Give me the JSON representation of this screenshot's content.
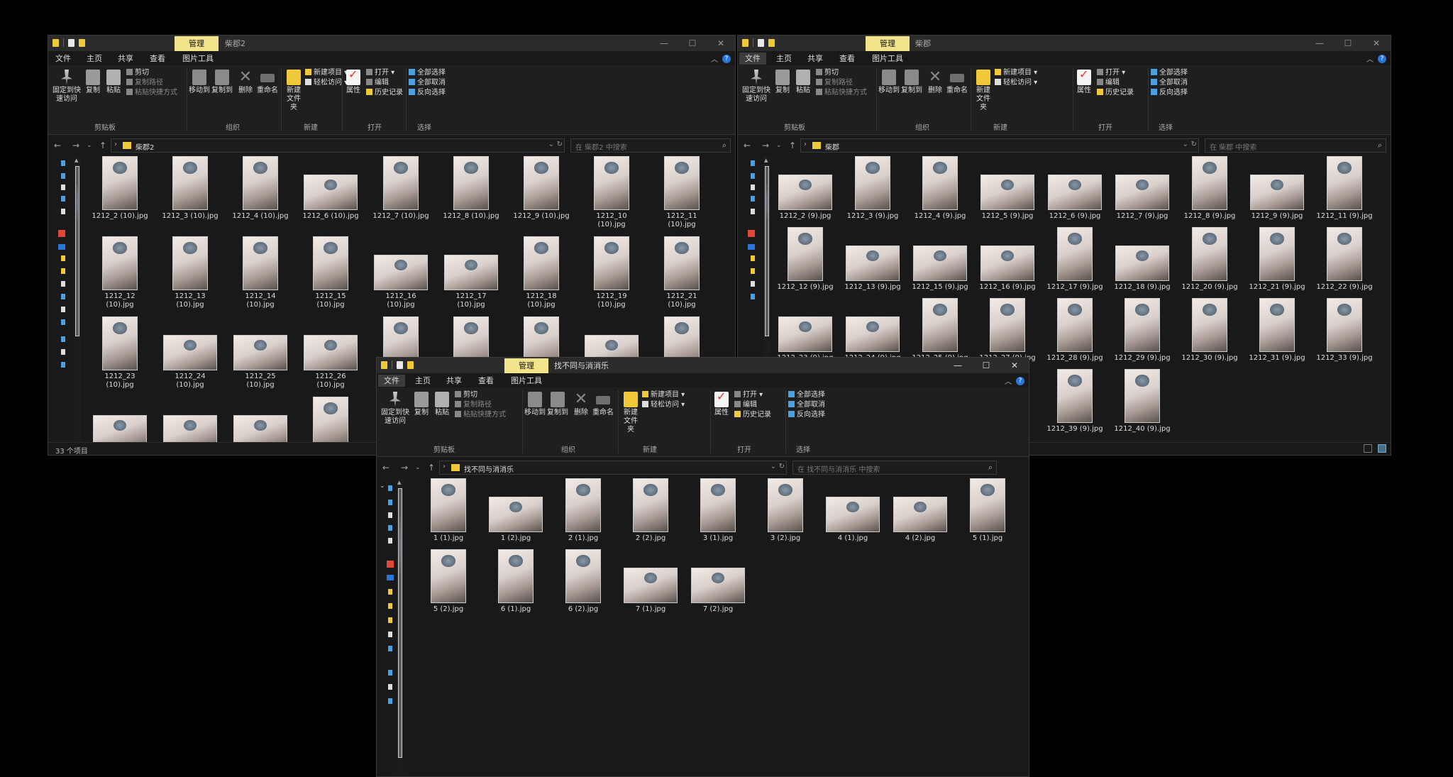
{
  "windows": [
    {
      "id": "w1",
      "manage_tab": "管理",
      "title": "柴郡2",
      "tabs": [
        "文件",
        "主页",
        "共享",
        "查看",
        "图片工具"
      ],
      "ribbon": {
        "pin": "固定到快速访问",
        "copy": "复制",
        "paste": "粘贴",
        "cut": "剪切",
        "copy_path": "复制路径",
        "paste_shortcut": "粘贴快捷方式",
        "move_to": "移动到",
        "copy_to": "复制到",
        "delete": "删除",
        "rename": "重命名",
        "new_folder": "新建文件夹",
        "new_item": "新建项目",
        "easy_access": "轻松访问",
        "properties": "属性",
        "open": "打开",
        "edit": "编辑",
        "history": "历史记录",
        "select_all": "全部选择",
        "select_none": "全部取消",
        "invert": "反向选择",
        "groups": [
          "剪贴板",
          "组织",
          "新建",
          "打开",
          "选择"
        ]
      },
      "address": "柴郡2",
      "search_placeholder": "在 柴郡2 中搜索",
      "status": "33 个项目",
      "files": [
        {
          "name": "1212_2 (10).jpg"
        },
        {
          "name": "1212_3 (10).jpg"
        },
        {
          "name": "1212_4 (10).jpg"
        },
        {
          "name": "1212_6 (10).jpg"
        },
        {
          "name": "1212_7 (10).jpg"
        },
        {
          "name": "1212_8 (10).jpg"
        },
        {
          "name": "1212_9 (10).jpg"
        },
        {
          "name": "1212_10\n(10).jpg"
        },
        {
          "name": "1212_11\n(10).jpg"
        },
        {
          "name": "1212_12\n(10).jpg"
        },
        {
          "name": "1212_13\n(10).jpg"
        },
        {
          "name": "1212_14\n(10).jpg"
        },
        {
          "name": "1212_15\n(10).jpg"
        },
        {
          "name": "1212_16\n(10).jpg"
        },
        {
          "name": "1212_17\n(10).jpg"
        },
        {
          "name": "1212_18\n(10).jpg"
        },
        {
          "name": "1212_19\n(10).jpg"
        },
        {
          "name": "1212_21\n(10).jpg"
        },
        {
          "name": "1212_23\n(10).jpg"
        },
        {
          "name": "1212_24\n(10).jpg"
        },
        {
          "name": "1212_25\n(10).jpg"
        },
        {
          "name": "1212_26\n(10).jpg"
        },
        {
          "name": ""
        },
        {
          "name": ""
        },
        {
          "name": ""
        },
        {
          "name": ""
        },
        {
          "name": ""
        },
        {
          "name": ""
        },
        {
          "name": ""
        },
        {
          "name": ""
        },
        {
          "name": ""
        }
      ]
    },
    {
      "id": "w2",
      "manage_tab": "管理",
      "title": "柴郡",
      "tabs": [
        "文件",
        "主页",
        "共享",
        "查看",
        "图片工具"
      ],
      "ribbon": {
        "pin": "固定到快速访问",
        "copy": "复制",
        "paste": "粘贴",
        "cut": "剪切",
        "copy_path": "复制路径",
        "paste_shortcut": "粘贴快捷方式",
        "move_to": "移动到",
        "copy_to": "复制到",
        "delete": "删除",
        "rename": "重命名",
        "new_folder": "新建文件夹",
        "new_item": "新建项目",
        "easy_access": "轻松访问",
        "properties": "属性",
        "open": "打开",
        "edit": "编辑",
        "history": "历史记录",
        "select_all": "全部选择",
        "select_none": "全部取消",
        "invert": "反向选择",
        "groups": [
          "剪贴板",
          "组织",
          "新建",
          "打开",
          "选择"
        ]
      },
      "address": "柴郡",
      "search_placeholder": "在 柴郡 中搜索",
      "files": [
        {
          "name": "1212_2 (9).jpg"
        },
        {
          "name": "1212_3 (9).jpg"
        },
        {
          "name": "1212_4 (9).jpg"
        },
        {
          "name": "1212_5 (9).jpg"
        },
        {
          "name": "1212_6 (9).jpg"
        },
        {
          "name": "1212_7 (9).jpg"
        },
        {
          "name": "1212_8 (9).jpg"
        },
        {
          "name": "1212_9 (9).jpg"
        },
        {
          "name": "1212_11 (9).jpg"
        },
        {
          "name": "1212_12 (9).jpg"
        },
        {
          "name": "1212_13 (9).jpg"
        },
        {
          "name": "1212_15 (9).jpg"
        },
        {
          "name": "1212_16 (9).jpg"
        },
        {
          "name": "1212_17 (9).jpg"
        },
        {
          "name": "1212_18 (9).jpg"
        },
        {
          "name": "1212_20 (9).jpg"
        },
        {
          "name": "1212_21 (9).jpg"
        },
        {
          "name": "1212_22 (9).jpg"
        },
        {
          "name": "1212_23 (9).jpg"
        },
        {
          "name": "1212_24 (9).jpg"
        },
        {
          "name": "1212_25 (9).jpg"
        },
        {
          "name": "1212_27 (9).jpg"
        },
        {
          "name": "1212_28 (9).jpg"
        },
        {
          "name": "1212_29 (9).jpg"
        },
        {
          "name": "1212_30 (9).jpg"
        },
        {
          "name": "1212_31 (9).jpg"
        },
        {
          "name": "1212_33 (9).jpg"
        },
        {
          "name": "jpg"
        },
        {
          "name": "1212_39 (9).jpg"
        },
        {
          "name": "1212_40 (9).jpg"
        }
      ]
    },
    {
      "id": "w3",
      "manage_tab": "管理",
      "title": "找不同与消消乐",
      "tabs": [
        "文件",
        "主页",
        "共享",
        "查看",
        "图片工具"
      ],
      "ribbon": {
        "pin": "固定到快速访问",
        "copy": "复制",
        "paste": "粘贴",
        "cut": "剪切",
        "copy_path": "复制路径",
        "paste_shortcut": "粘贴快捷方式",
        "move_to": "移动到",
        "copy_to": "复制到",
        "delete": "删除",
        "rename": "重命名",
        "new_folder": "新建文件夹",
        "new_item": "新建项目",
        "easy_access": "轻松访问",
        "properties": "属性",
        "open": "打开",
        "edit": "编辑",
        "history": "历史记录",
        "select_all": "全部选择",
        "select_none": "全部取消",
        "invert": "反向选择",
        "groups": [
          "剪贴板",
          "组织",
          "新建",
          "打开",
          "选择"
        ]
      },
      "address": "找不同与消消乐",
      "search_placeholder": "在 找不同与消消乐 中搜索",
      "files": [
        {
          "name": "1 (1).jpg"
        },
        {
          "name": "1 (2).jpg"
        },
        {
          "name": "2 (1).jpg"
        },
        {
          "name": "2 (2).jpg"
        },
        {
          "name": "3 (1).jpg"
        },
        {
          "name": "3 (2).jpg"
        },
        {
          "name": "4 (1).jpg"
        },
        {
          "name": "4 (2).jpg"
        },
        {
          "name": "5 (1).jpg"
        },
        {
          "name": "5 (2).jpg"
        },
        {
          "name": "6 (1).jpg"
        },
        {
          "name": "6 (2).jpg"
        },
        {
          "name": "7 (1).jpg"
        },
        {
          "name": "7 (2).jpg"
        }
      ]
    }
  ]
}
